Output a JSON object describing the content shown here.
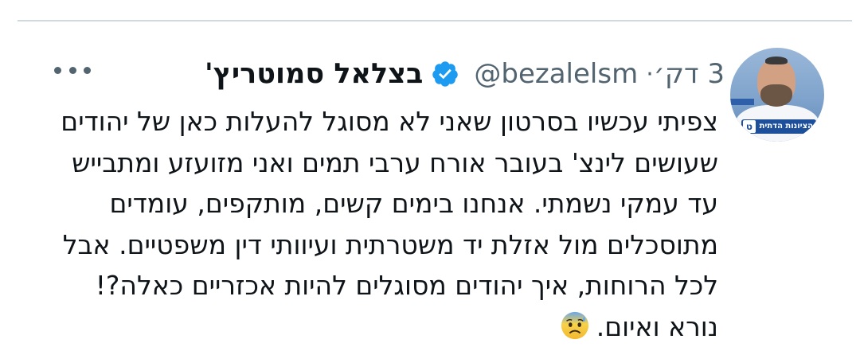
{
  "tweet": {
    "author": {
      "display_name": "בצלאל סמוטריץ'",
      "handle": "@bezalelsm",
      "verified": true,
      "avatar_badge_text": "הציונות הדתית",
      "avatar_badge_letter": "ט"
    },
    "separator": "·",
    "timestamp": "3 דק׳",
    "more_icon": "ellipsis-icon",
    "text_lines": [
      "צפיתי עכשיו בסרטון שאני לא מסוגל להעלות כאן של יהודים",
      "שעושים לינצ' בעובר אורח ערבי תמים ואני מזועזע ומתבייש",
      "עד עמקי נשמתי. אנחנו בימים קשים, מותקפים, עומדים",
      "מתוסכלים מול אזלת יד משטרתית ועיוותי דין משפטיים. אבל",
      "לכל הרוחות, איך יהודים מסוגלים להיות אכזריים כאלה?!",
      "נורא ואיום."
    ],
    "end_emoji": "anxious-face-with-sweat-emoji"
  },
  "colors": {
    "text_primary": "#0f1419",
    "text_secondary": "#536471",
    "verified_blue": "#1d9bf0",
    "divider": "#cfd9de"
  }
}
